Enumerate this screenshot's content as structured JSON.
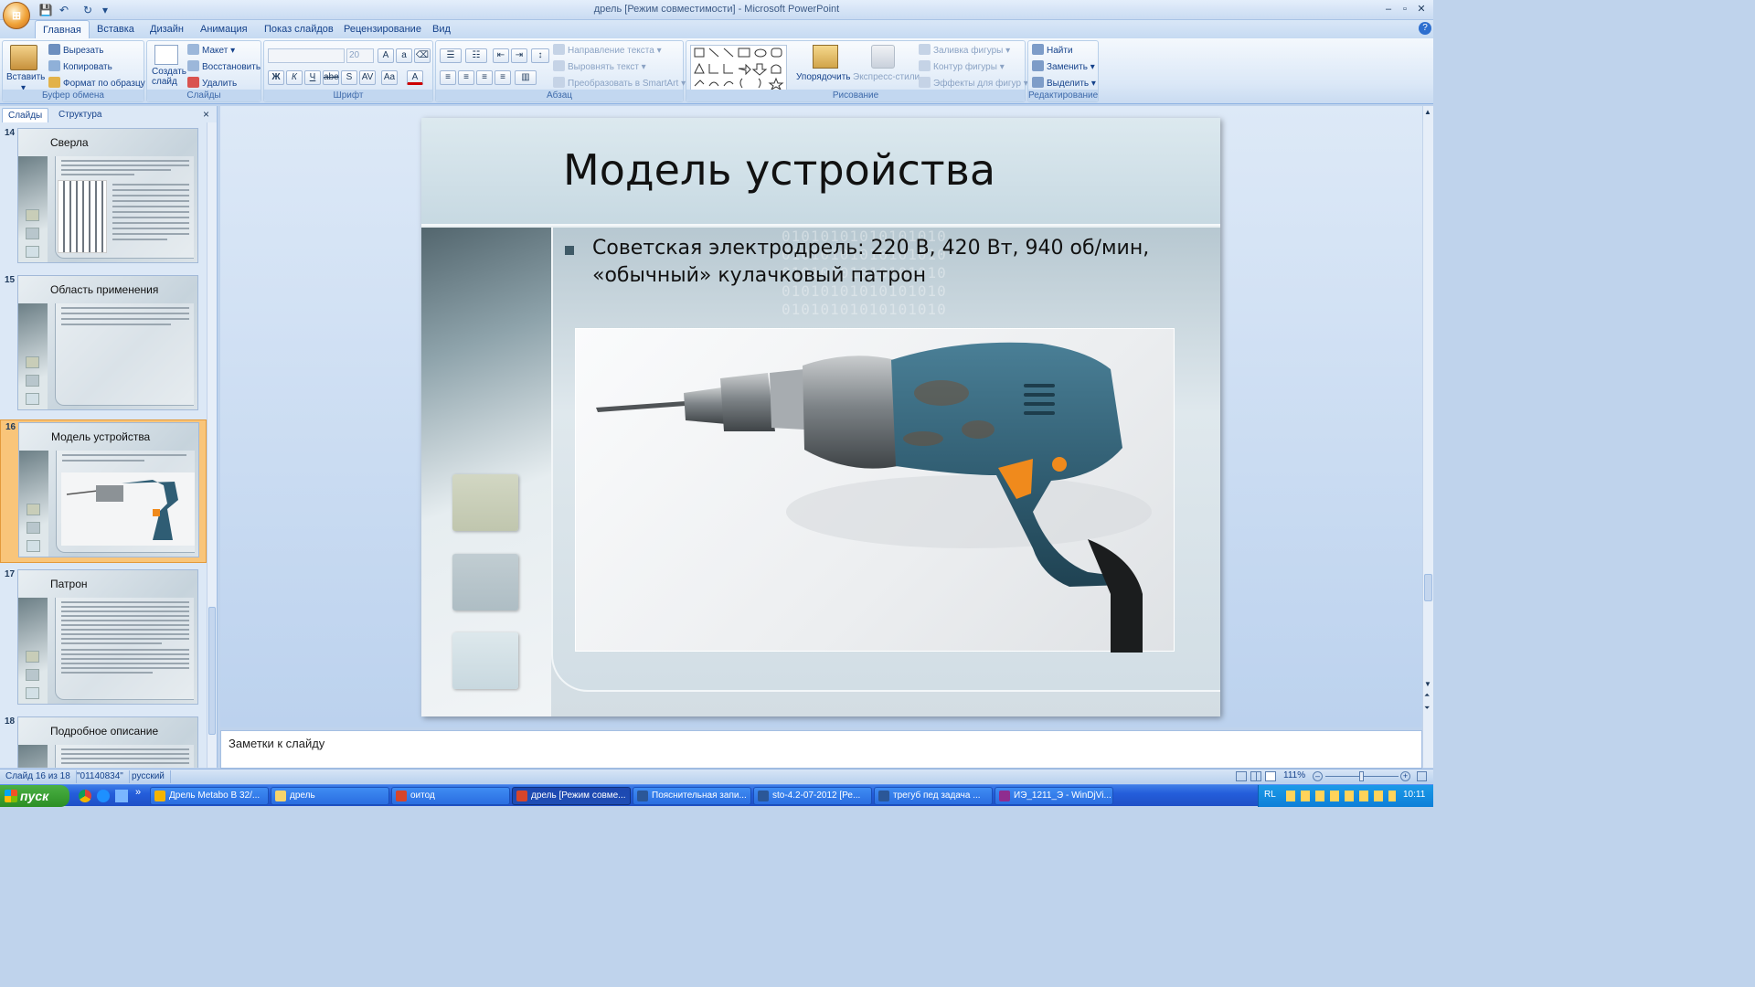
{
  "window": {
    "title": "дрель [Режим совместимости] - Microsoft PowerPoint",
    "min": "–",
    "max": "▫",
    "close": "✕",
    "help": "?"
  },
  "office_button": "⊞",
  "ribbon_tabs": [
    "Главная",
    "Вставка",
    "Дизайн",
    "Анимация",
    "Показ слайдов",
    "Рецензирование",
    "Вид"
  ],
  "clipboard": {
    "paste": "Вставить",
    "cut": "Вырезать",
    "copy": "Копировать",
    "format_painter": "Формат по образцу",
    "label": "Буфер обмена"
  },
  "slides_group": {
    "new_slide": "Создать слайд",
    "layout": "Макет",
    "reset": "Восстановить",
    "delete": "Удалить",
    "label": "Слайды"
  },
  "font_group": {
    "size": "20",
    "label": "Шрифт",
    "buttons": [
      "Ж",
      "К",
      "Ч",
      "abe",
      "S",
      "AV",
      "Aa",
      "A"
    ]
  },
  "paragraph_group": {
    "text_direction": "Направление текста",
    "align_text": "Выровнять текст",
    "smartart": "Преобразовать в SmartArt",
    "label": "Абзац"
  },
  "drawing_group": {
    "arrange": "Упорядочить",
    "quick_styles": "Экспресс-стили",
    "fill": "Заливка фигуры",
    "outline": "Контур фигуры",
    "effects": "Эффекты для фигур",
    "label": "Рисование"
  },
  "editing_group": {
    "find": "Найти",
    "replace": "Заменить",
    "select": "Выделить",
    "label": "Редактирование"
  },
  "panel_tabs": {
    "slides": "Слайды",
    "outline": "Структура",
    "close": "×"
  },
  "thumbnails": [
    {
      "num": "14",
      "title": "Сверла"
    },
    {
      "num": "15",
      "title": "Область применения"
    },
    {
      "num": "16",
      "title": "Модель устройства"
    },
    {
      "num": "17",
      "title": "Патрон"
    },
    {
      "num": "18",
      "title": "Подробное описание"
    }
  ],
  "slide": {
    "title": "Модель устройства",
    "bullet": "Советская электродрель: 220 В, 420 Вт, 940 об/мин, «обычный» кулачковый патрон",
    "binary": "01010101010101010"
  },
  "notes_placeholder": "Заметки к слайду",
  "status": {
    "slide": "Слайд 16 из 18",
    "theme": "\"01140834\"",
    "language": "русский",
    "zoom": "111%"
  },
  "taskbar": {
    "start": "пуск",
    "items": [
      "Дрель Metabo B 32/...",
      "дрель",
      "оитод",
      "дрель [Режим совме...",
      "Пояснительная запи...",
      "sto-4.2-07-2012 [Ре...",
      "трегуб пед задача ...",
      "ИЭ_1211_Э - WinDjVi..."
    ],
    "lang": "RL",
    "time": "10:11"
  }
}
